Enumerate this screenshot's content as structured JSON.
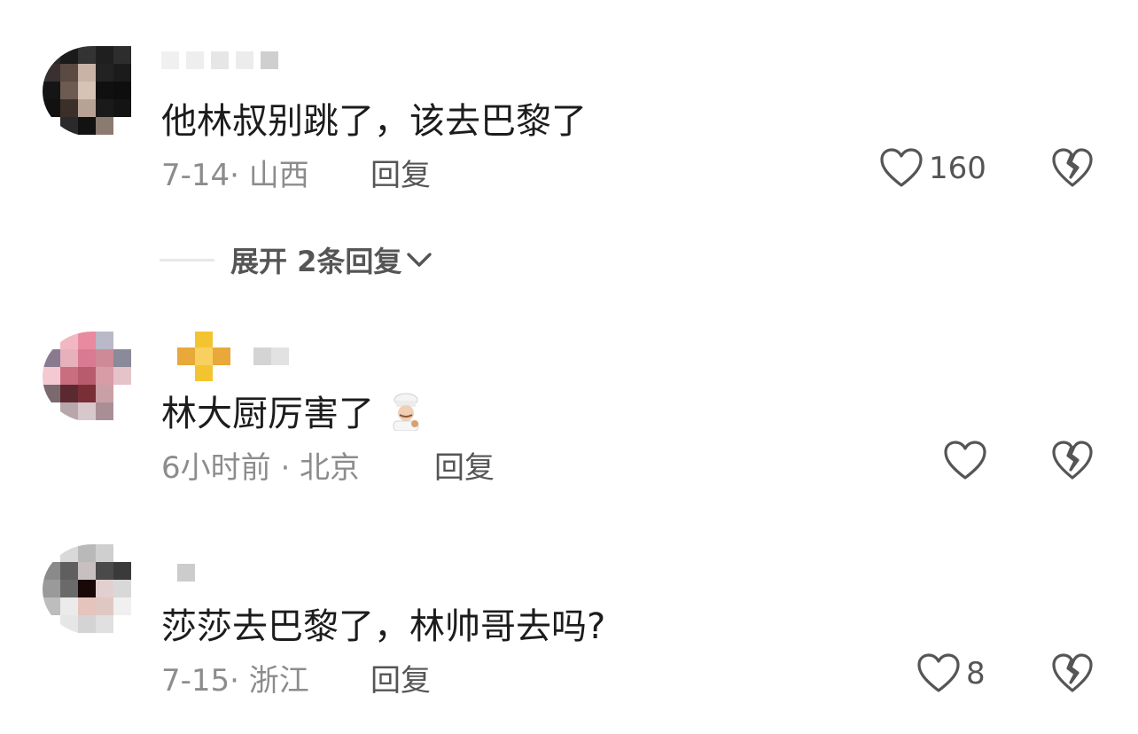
{
  "comments": [
    {
      "text": "他林叔别跳了，该去巴黎了",
      "meta": "7-14· 山西",
      "reply_label": "回复",
      "likes": "160"
    },
    {
      "text": "林大厨厉害了",
      "meta": "6小时前 · 北京",
      "reply_label": "回复",
      "likes": ""
    },
    {
      "text": "莎莎去巴黎了，林帅哥去吗?",
      "meta": "7-15· 浙江",
      "reply_label": "回复",
      "likes": "8"
    }
  ],
  "expand_replies_label": "展开 2条回复",
  "icons": {
    "like": "heart-outline-icon",
    "dislike": "broken-heart-icon",
    "expand": "chevron-down-icon",
    "emoji": "chef-emoji-icon"
  },
  "colors": {
    "text": "#1c1c1c",
    "meta": "#8c8c8c",
    "action": "#555555"
  }
}
